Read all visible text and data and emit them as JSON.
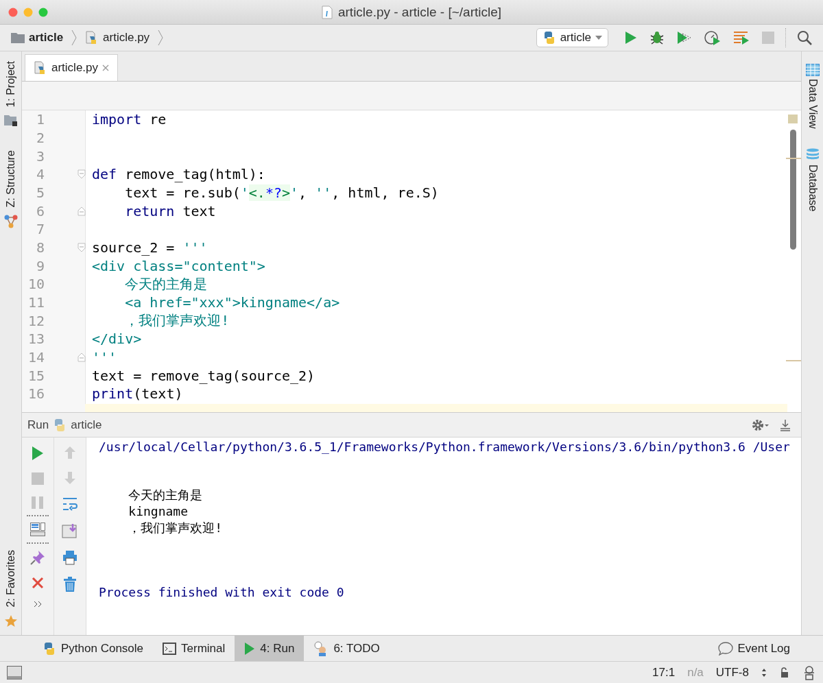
{
  "window": {
    "title": "article.py - article - [~/article]"
  },
  "navigation_bar": {
    "breadcrumbs": [
      {
        "label": "article",
        "kind": "folder"
      },
      {
        "label": "article.py",
        "kind": "python-file"
      }
    ],
    "run_configuration": "article"
  },
  "editor_tabs": [
    {
      "label": "article.py",
      "selected": true
    }
  ],
  "left_tool_windows": [
    {
      "label": "1: Project",
      "kind": "project"
    },
    {
      "label": "Z: Structure",
      "kind": "structure"
    }
  ],
  "left_bottom_tool_windows": [
    {
      "label": "2: Favorites",
      "kind": "favorites"
    }
  ],
  "right_tool_windows": [
    {
      "label": "Data View",
      "kind": "data-view"
    },
    {
      "label": "Database",
      "kind": "database"
    }
  ],
  "editor": {
    "lines": [
      {
        "number": "1",
        "kind": "code",
        "tokens": [
          {
            "text": "import",
            "kind": "keyword"
          },
          {
            "text": " re",
            "kind": "plain"
          }
        ]
      },
      {
        "number": "2",
        "kind": "code"
      },
      {
        "number": "3",
        "kind": "code"
      },
      {
        "number": "4",
        "kind": "fold-start",
        "tokens": [
          {
            "text": "def",
            "kind": "keyword"
          },
          {
            "text": " remove_tag(html):",
            "kind": "plain"
          }
        ]
      },
      {
        "number": "5",
        "kind": "code",
        "tokens": [
          {
            "text": "    text = re.sub(",
            "kind": "plain"
          },
          {
            "text": "'",
            "kind": "string"
          },
          {
            "text": "<.",
            "kind": "regex"
          },
          {
            "text": "*?",
            "kind": "regex-meta"
          },
          {
            "text": ">",
            "kind": "regex"
          },
          {
            "text": "'",
            "kind": "string"
          },
          {
            "text": ", ",
            "kind": "plain"
          },
          {
            "text": "''",
            "kind": "string"
          },
          {
            "text": ", html, re.S)",
            "kind": "plain"
          }
        ]
      },
      {
        "number": "6",
        "kind": "fold-end",
        "tokens": [
          {
            "text": "    return",
            "kind": "keyword"
          },
          {
            "text": " text",
            "kind": "plain"
          }
        ]
      },
      {
        "number": "7",
        "kind": "code"
      },
      {
        "number": "8",
        "kind": "fold-start",
        "tokens": [
          {
            "text": "source_2 = ",
            "kind": "plain"
          },
          {
            "text": "'''",
            "kind": "string"
          }
        ]
      },
      {
        "number": "9",
        "kind": "code",
        "tokens": [
          {
            "text": "<div class=\"content\">",
            "kind": "string"
          }
        ]
      },
      {
        "number": "10",
        "kind": "code",
        "tokens": [
          {
            "text": "    今天的主角是",
            "kind": "string"
          }
        ]
      },
      {
        "number": "11",
        "kind": "code",
        "tokens": [
          {
            "text": "    <a href=\"xxx\">kingname</a>",
            "kind": "string"
          }
        ]
      },
      {
        "number": "12",
        "kind": "code",
        "tokens": [
          {
            "text": "    ，我们掌声欢迎!",
            "kind": "string"
          }
        ]
      },
      {
        "number": "13",
        "kind": "code",
        "tokens": [
          {
            "text": "</div>",
            "kind": "string"
          }
        ]
      },
      {
        "number": "14",
        "kind": "fold-end",
        "tokens": [
          {
            "text": "'''",
            "kind": "string"
          }
        ]
      },
      {
        "number": "15",
        "kind": "code",
        "tokens": [
          {
            "text": "text = remove_tag(source_2)",
            "kind": "plain"
          }
        ]
      },
      {
        "number": "16",
        "kind": "code",
        "tokens": [
          {
            "text": "print",
            "kind": "keyword"
          },
          {
            "text": "(text)",
            "kind": "plain"
          }
        ]
      }
    ]
  },
  "run_panel": {
    "title": "Run",
    "configuration": "article",
    "console": {
      "command": "/usr/local/Cellar/python/3.6.5_1/Frameworks/Python.framework/Versions/3.6/bin/python3.6 /User",
      "output": [
        "    今天的主角是",
        "    kingname",
        "    ，我们掌声欢迎!"
      ],
      "exit_message": "Process finished with exit code 0"
    }
  },
  "bottom_tabs": [
    {
      "label": "Python Console",
      "kind": "python",
      "selected": false
    },
    {
      "label": "Terminal",
      "kind": "terminal",
      "selected": false
    },
    {
      "label": "4: Run",
      "kind": "run",
      "selected": true
    },
    {
      "label": "6: TODO",
      "kind": "todo",
      "selected": false
    }
  ],
  "event_log": "Event Log",
  "status_bar": {
    "position": "17:1",
    "indent": "n/a",
    "encoding": "UTF-8"
  }
}
